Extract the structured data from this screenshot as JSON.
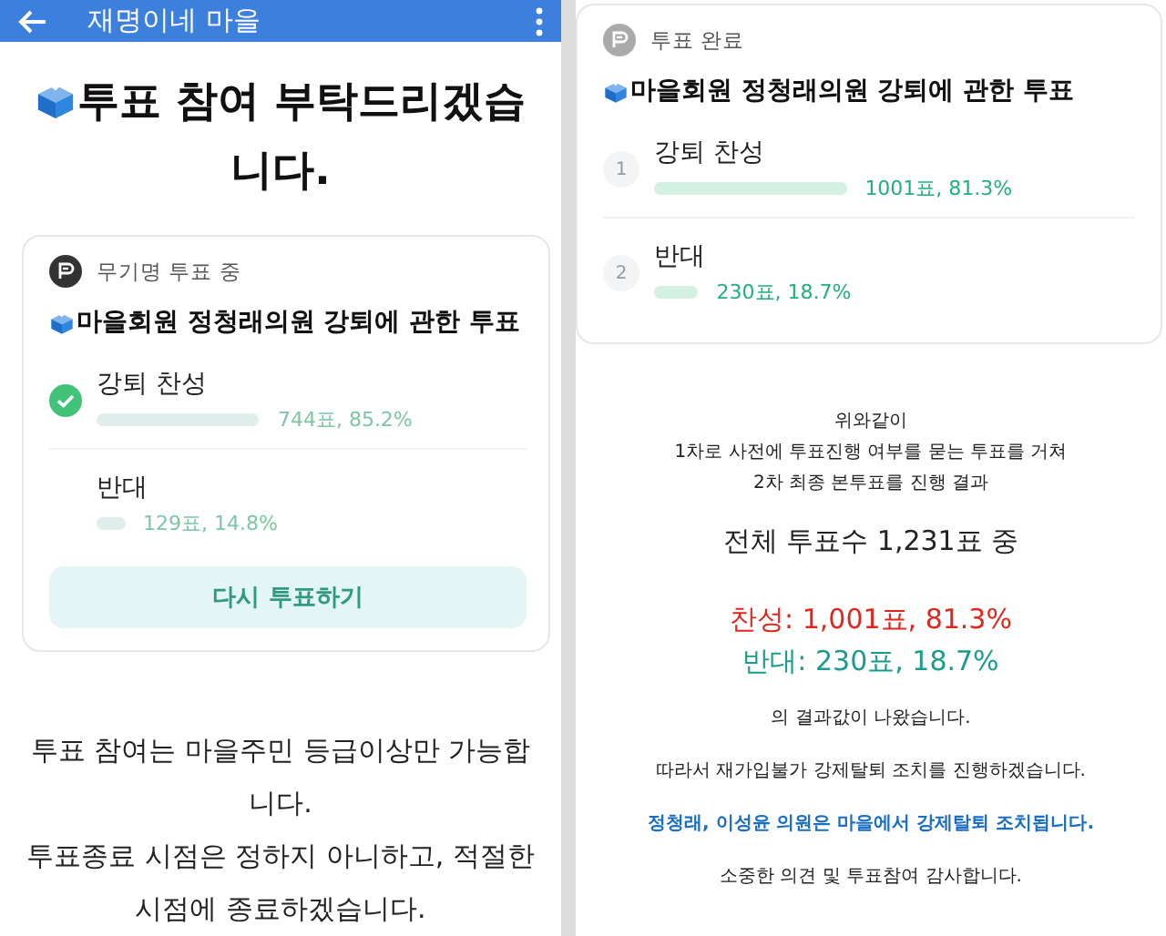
{
  "left": {
    "app_bar": {
      "title": "재명이네 마을"
    },
    "heading": "투표 참여 부탁드리겠습니다.",
    "poll": {
      "active": true,
      "status": "무기명 투표 중",
      "title": "마을회원 정청래의원 강퇴에 관한 투표",
      "options": [
        {
          "label": "강퇴 찬성",
          "result": "744표, 85.2%",
          "checked": true
        },
        {
          "label": "반대",
          "result": "129표, 14.8%",
          "checked": false
        }
      ],
      "button": "다시 투표하기"
    },
    "notice": [
      "투표 참여는 마을주민 등급이상만 가능합니다.",
      "투표종료 시점은 정하지 아니하고, 적절한 시점에 종료하겠습니다."
    ]
  },
  "right": {
    "poll": {
      "active": false,
      "status": "투표 완료",
      "title": "마을회원 정청래의원 강퇴에 관한 투표",
      "options": [
        {
          "number": "1",
          "label": "강퇴 찬성",
          "result": "1001표, 81.3%"
        },
        {
          "number": "2",
          "label": "반대",
          "result": "230표, 18.7%"
        }
      ]
    },
    "message": [
      {
        "kind": "intro",
        "text": "위와같이"
      },
      {
        "kind": "intro",
        "text": "1차로 사전에 투표진행 여부를 묻는 투표를 거쳐"
      },
      {
        "kind": "intro",
        "text": "2차 최종 본투표를 진행 결과"
      },
      {
        "kind": "total",
        "text": "전체 투표수 1,231표 중"
      },
      {
        "kind": "for",
        "text": "찬성: 1,001표, 81.3%"
      },
      {
        "kind": "against",
        "text": "반대: 230표, 18.7%"
      },
      {
        "kind": "note",
        "text": "의 결과값이 나왔습니다."
      },
      {
        "kind": "note",
        "text": "따라서 재가입불가 강제탈퇴 조치를 진행하겠습니다."
      },
      {
        "kind": "highlight",
        "text": "정청래, 이성윤 의원은 마을에서 강제탈퇴 조치됩니다."
      },
      {
        "kind": "note",
        "text": "소중한 의견 및 투표참여 감사합니다."
      }
    ]
  }
}
